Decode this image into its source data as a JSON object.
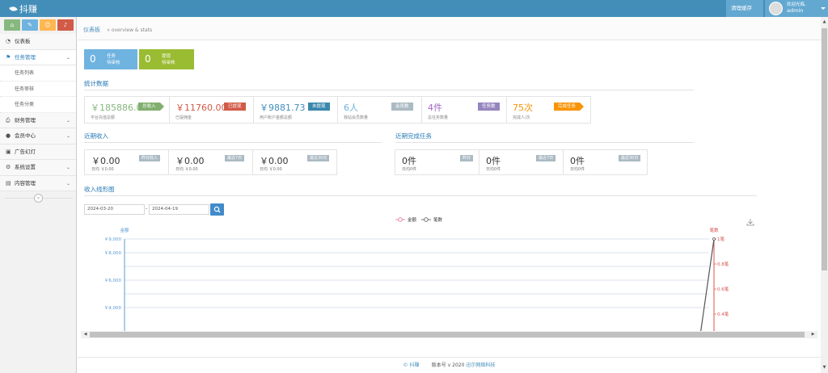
{
  "app": {
    "brand": "抖赚"
  },
  "topbar": {
    "clear_cache": "清理缓存",
    "welcome": "欢迎光临,",
    "username": "admin"
  },
  "shortcuts": [
    {
      "icon": "home-icon",
      "glyph": "⌂",
      "color": "#87b87f"
    },
    {
      "icon": "pencil-icon",
      "glyph": "✎",
      "color": "#6fb3e0"
    },
    {
      "icon": "users-icon",
      "glyph": "☺",
      "color": "#ffb752"
    },
    {
      "icon": "bell-icon",
      "glyph": "♪",
      "color": "#d15b47"
    }
  ],
  "sidebar": {
    "dashboard": "仪表板",
    "task_manage": "任务管理",
    "task_list": "任务列表",
    "task_review": "任务审核",
    "task_category": "任务分类",
    "finance": "财务管理",
    "members": "会员中心",
    "slides": "广告幻灯",
    "settings": "系统设置",
    "content": "内容管理",
    "collapse_glyph": "«"
  },
  "breadcrumb": {
    "home": "仪表板",
    "sub": "overview & stats"
  },
  "quick": [
    {
      "num": "0",
      "line1": "任务",
      "line2": "待审核",
      "color": "#6fb3e0"
    },
    {
      "num": "0",
      "line1": "提现",
      "line2": "待审核",
      "color": "#9abc32"
    }
  ],
  "stats_title": "统计数据",
  "stats": [
    {
      "value": "￥185886.0",
      "sub": "平台充值总额",
      "tag": "总收入",
      "color": "#87b87f",
      "tagcolor": "#82af6f"
    },
    {
      "value": "￥11760.00",
      "sub": "已提佣金",
      "tag": "已提现",
      "color": "#d15b47",
      "tagcolor": "#d15b47"
    },
    {
      "value": "￥9881.73",
      "sub": "用户账户金额总额",
      "tag": "未提现",
      "color": "#438eb9",
      "tagcolor": "#3a87ad"
    },
    {
      "value": "6人",
      "sub": "我站会员数量",
      "tag": "会员数",
      "color": "#6fb3e0",
      "tagcolor": "#abbac3"
    },
    {
      "value": "4件",
      "sub": "总任务数量",
      "tag": "任务数",
      "color": "#a069c3",
      "tagcolor": "#9585bf"
    },
    {
      "value": "75次",
      "sub": "完成人/次",
      "tag": "完成任务",
      "color": "#f89406",
      "tagcolor": "#f89406"
    }
  ],
  "income_title": "近期收入",
  "income": [
    {
      "value": "￥0.00",
      "sub": "日均 ￥0.00",
      "tag": "昨日收入"
    },
    {
      "value": "￥0.00",
      "sub": "日均 ￥0.00",
      "tag": "最近7日"
    },
    {
      "value": "￥0.00",
      "sub": "日均 ￥0.00",
      "tag": "最近30日"
    }
  ],
  "tasks_title": "近期完成任务",
  "tasks": [
    {
      "value": "0件",
      "sub": "日均0件",
      "tag": "昨日"
    },
    {
      "value": "0件",
      "sub": "日均0件",
      "tag": "最近7日"
    },
    {
      "value": "0件",
      "sub": "日均0件",
      "tag": "最近30日"
    }
  ],
  "chart_section_title": "收入线形图",
  "date_from": "2024-03-20",
  "date_sep": "-",
  "date_to": "2024-04-19",
  "chart_data": {
    "type": "line",
    "legend_position": "top-center",
    "series": [
      {
        "name": "金额",
        "color": "#e0708a",
        "axis": "left"
      },
      {
        "name": "笔数",
        "color": "#555555",
        "axis": "right"
      }
    ],
    "left_axis": {
      "label": "金额",
      "ticks": [
        "￥9,000",
        "￥8,000",
        "￥6,000",
        "￥4,000"
      ],
      "tick_values": [
        9000,
        8000,
        6000,
        4000
      ],
      "range": [
        0,
        9000
      ],
      "color": "#5b9bd5"
    },
    "right_axis": {
      "label": "笔数",
      "ticks": [
        "1笔",
        "0.8笔",
        "0.6笔",
        "0.4笔"
      ],
      "tick_values": [
        1,
        0.8,
        0.6,
        0.4
      ],
      "range": [
        0,
        1
      ],
      "color": "#d9534f"
    },
    "count_line_end": 1,
    "grid": true
  },
  "footer": {
    "brand": "© 抖赚",
    "version": "版本号 v 2020",
    "company": "迅尔网络科技"
  }
}
